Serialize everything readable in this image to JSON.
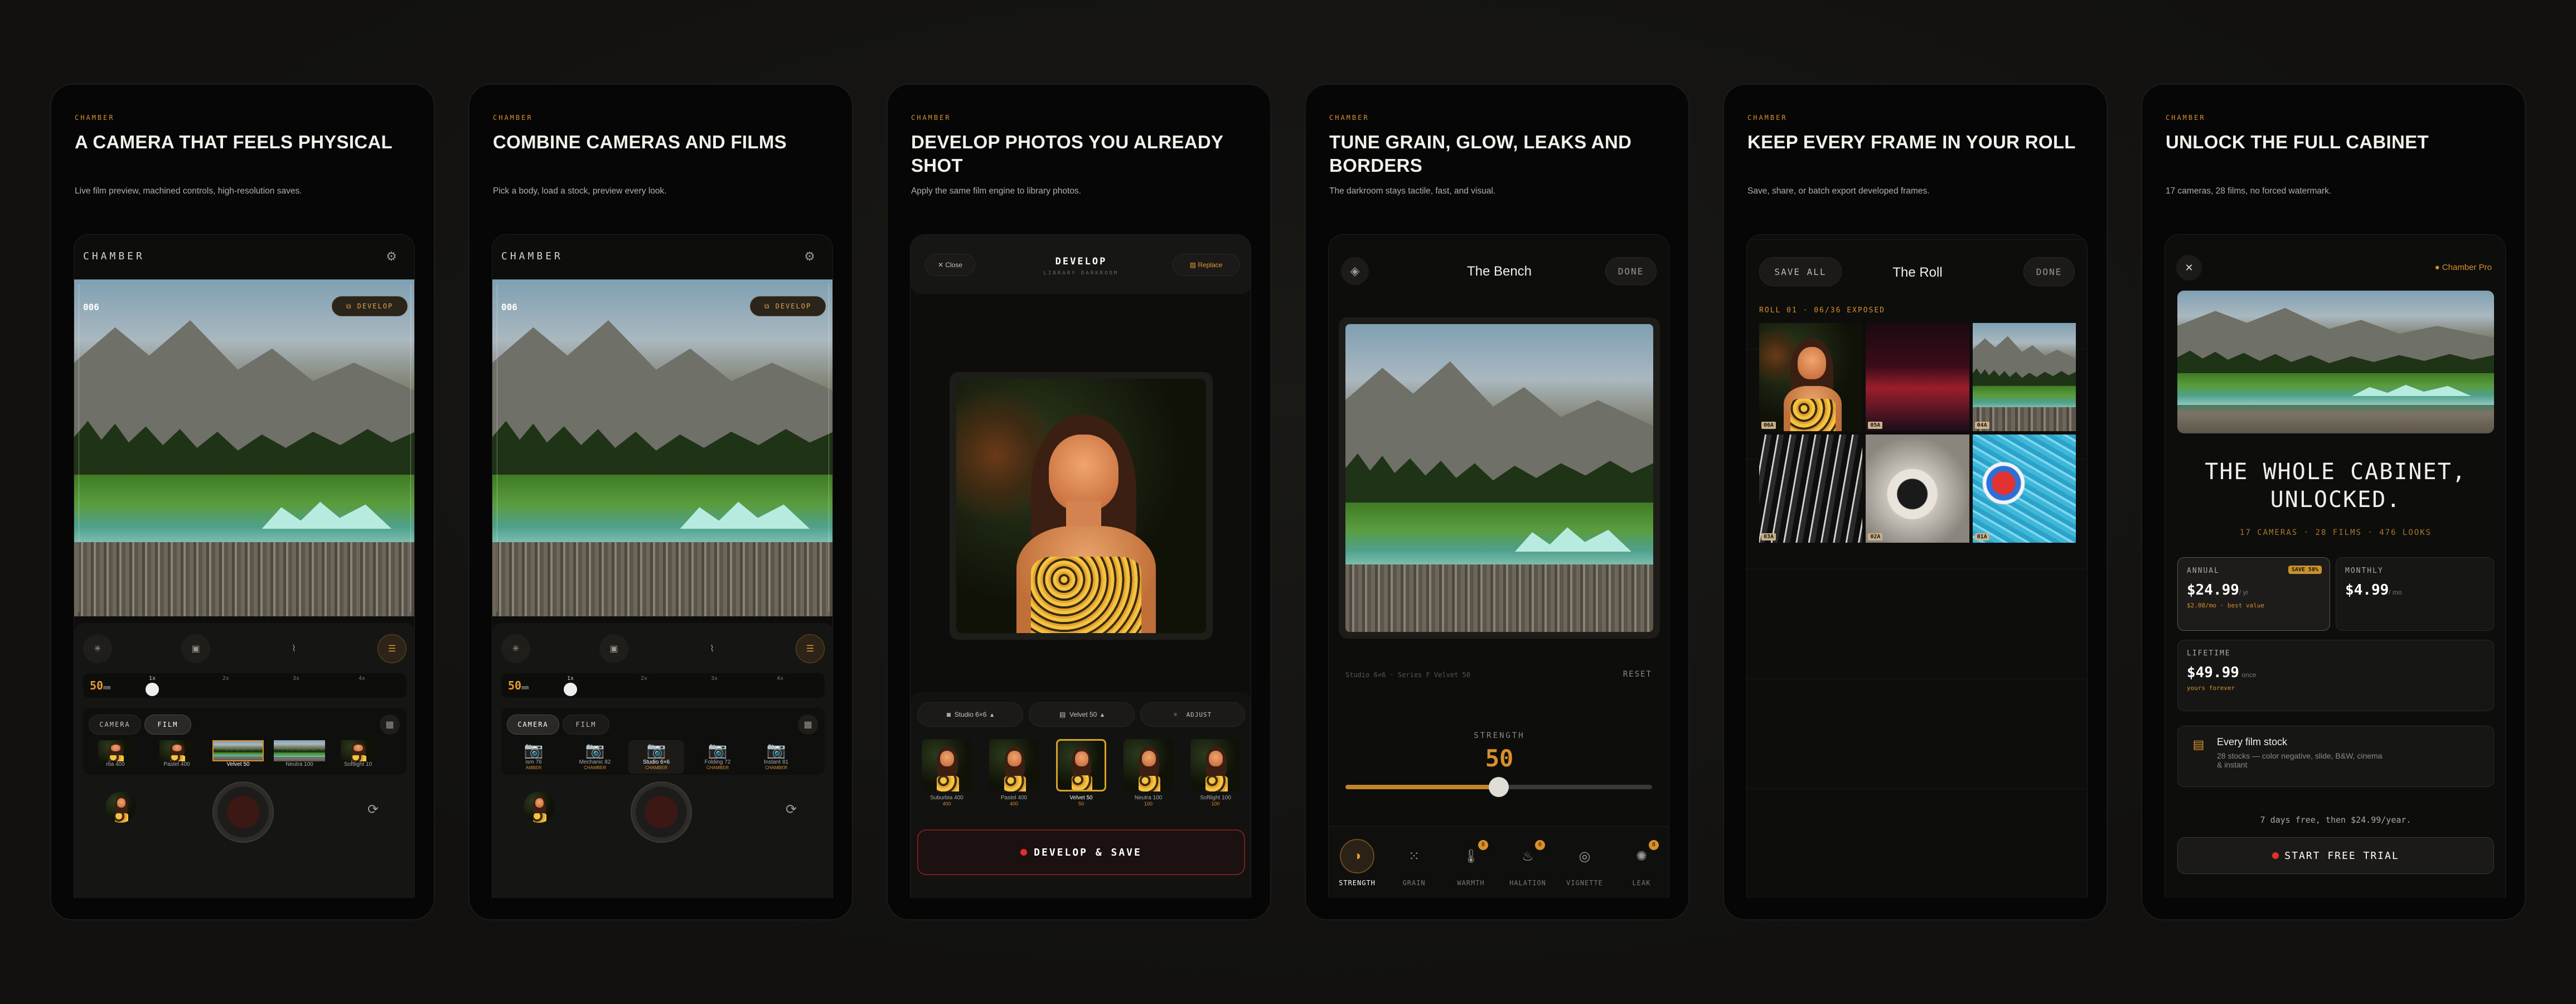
{
  "colors": {
    "accent": "#d98f2b",
    "background": "#141311",
    "panel": "#060606",
    "trial_red": "#e0302a"
  },
  "panels": [
    {
      "eyebrow": "CHAMBER",
      "title": "A CAMERA THAT FEELS PHYSICAL",
      "subtitle": "Live film preview, machined controls, high-resolution saves.",
      "screen": {
        "app_name": "CHAMBER",
        "frame_counter": "006",
        "develop_badge": "DEVELOP",
        "focal": "50",
        "focal_unit": "mm",
        "zoom_stops": [
          "1x",
          "2x",
          "3x",
          "4x",
          "5x"
        ],
        "tabs": [
          "CAMERA",
          "FILM"
        ],
        "active_tab": "FILM",
        "films": [
          {
            "name": "rtia 400",
            "iso": "50"
          },
          {
            "name": "Pastel 400",
            "iso": "400"
          },
          {
            "name": "Velvet 50",
            "iso": "50"
          },
          {
            "name": "Neutra 100",
            "iso": "100"
          },
          {
            "name": "Softlight 10",
            "iso": "100"
          }
        ],
        "selected_film": "Velvet 50"
      }
    },
    {
      "eyebrow": "CHAMBER",
      "title": "COMBINE CAMERAS AND FILMS",
      "subtitle": "Pick a body, load a stock, preview every look.",
      "screen": {
        "app_name": "CHAMBER",
        "frame_counter": "006",
        "develop_badge": "DEVELOP",
        "focal": "50",
        "focal_unit": "mm",
        "zoom_stops": [
          "1x",
          "2x",
          "3x",
          "4x",
          "5x"
        ],
        "tabs": [
          "CAMERA",
          "FILM"
        ],
        "active_tab": "CAMERA",
        "cameras": [
          {
            "name": "ism 76",
            "brand": "AMBER"
          },
          {
            "name": "Mechanic 82",
            "brand": "CHAMBER"
          },
          {
            "name": "Studio 6×6",
            "brand": "CHAMBER"
          },
          {
            "name": "Folding 72",
            "brand": "CHAMBER"
          },
          {
            "name": "Instant 81",
            "brand": "CHAMBER"
          }
        ],
        "selected_camera": "Studio 6×6"
      }
    },
    {
      "eyebrow": "CHAMBER",
      "title": "DEVELOP PHOTOS YOU ALREADY SHOT",
      "subtitle": "Apply the same film engine to library photos.",
      "screen": {
        "close": "Close",
        "header_title": "DEVELOP",
        "header_subtitle": "LIBRARY DARKROOM",
        "replace": "Replace",
        "camera_chip": "Studio 6×6",
        "film_chip": "Velvet 50",
        "adjust_chip": "ADJUST",
        "films": [
          {
            "name": "Suburbia 400",
            "iso": "400"
          },
          {
            "name": "Pastel 400",
            "iso": "400"
          },
          {
            "name": "Velvet 50",
            "iso": "50"
          },
          {
            "name": "Neutra 100",
            "iso": "100"
          },
          {
            "name": "Softlight 100",
            "iso": "100"
          }
        ],
        "selected_film": "Velvet 50",
        "action": "DEVELOP & SAVE"
      }
    },
    {
      "eyebrow": "CHAMBER",
      "title": "TUNE GRAIN, GLOW, LEAKS AND BORDERS",
      "subtitle": "The darkroom stays tactile, fast, and visual.",
      "screen": {
        "header_title": "The Bench",
        "done": "DONE",
        "caption": "Studio 6×6 · Series F Velvet 50",
        "reset": "RESET",
        "strength_label": "STRENGTH",
        "strength_value": "50",
        "strength_fraction": 0.5,
        "tools": [
          {
            "label": "STRENGTH",
            "badge": ""
          },
          {
            "label": "GRAIN",
            "badge": ""
          },
          {
            "label": "WARMTH",
            "badge": "8"
          },
          {
            "label": "HALATION",
            "badge": "6"
          },
          {
            "label": "VIGNETTE",
            "badge": ""
          },
          {
            "label": "LEAK",
            "badge": "8"
          }
        ]
      }
    },
    {
      "eyebrow": "CHAMBER",
      "title": "KEEP EVERY FRAME IN YOUR ROLL",
      "subtitle": "Save, share, or batch export developed frames.",
      "screen": {
        "save_all": "SAVE ALL",
        "header_title": "The Roll",
        "done": "DONE",
        "roll_info": "ROLL 01 · 06/36 EXPOSED",
        "frames": [
          {
            "tag": "06A"
          },
          {
            "tag": "05A"
          },
          {
            "tag": "04A"
          },
          {
            "tag": "03A"
          },
          {
            "tag": "02A"
          },
          {
            "tag": "01A"
          }
        ]
      }
    },
    {
      "eyebrow": "CHAMBER",
      "title": "UNLOCK THE FULL CABINET",
      "subtitle": "17 cameras, 28 films, no forced watermark.",
      "screen": {
        "pro_label": "Chamber Pro",
        "headline_1": "THE WHOLE CABINET,",
        "headline_2": "UNLOCKED.",
        "stats": "17 CAMERAS · 28 FILMS · 476 LOOKS",
        "plans": [
          {
            "name": "ANNUAL",
            "badge": "SAVE 58%",
            "price": "$24.99",
            "period": "/ yr",
            "note": "$2.08/mo · best value"
          },
          {
            "name": "MONTHLY",
            "price": "$4.99",
            "period": "/ mo"
          },
          {
            "name": "LIFETIME",
            "price": "$49.99",
            "period": "once",
            "note": "yours forever"
          }
        ],
        "feature_title": "Every film stock",
        "feature_desc_1": "28 stocks — color negative, slide, B&W, cinema",
        "feature_desc_2": "& instant",
        "trial_note": "7 days free, then $24.99/year.",
        "trial_button": "START FREE TRIAL"
      }
    }
  ]
}
